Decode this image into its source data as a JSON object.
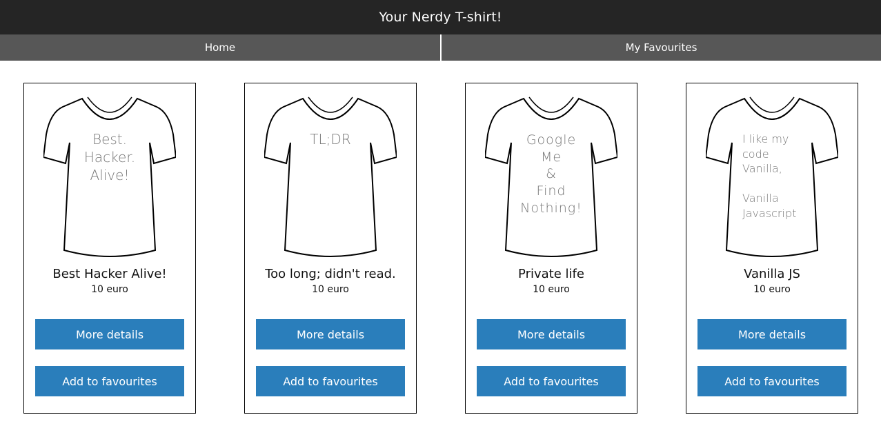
{
  "header": {
    "title": "Your Nerdy T-shirt!"
  },
  "nav": {
    "home": "Home",
    "favourites": "My Favourites"
  },
  "products": [
    {
      "shirt_text": "Best.\nHacker.\nAlive!",
      "title": "Best Hacker Alive!",
      "price": "10 euro",
      "details_label": "More details",
      "fav_label": "Add to favourites"
    },
    {
      "shirt_text": "TL;DR",
      "title": "Too long; didn't read.",
      "price": "10 euro",
      "details_label": "More details",
      "fav_label": "Add to favourites"
    },
    {
      "shirt_text": "Google\nMe\n&\nFind\nNothing!",
      "title": "Private life",
      "price": "10 euro",
      "details_label": "More details",
      "fav_label": "Add to favourites"
    },
    {
      "shirt_text": "I like my\ncode\nVanilla,\n\nVanilla\nJavascript",
      "title": "Vanilla JS",
      "price": "10 euro",
      "details_label": "More details",
      "fav_label": "Add to favourites"
    }
  ],
  "colors": {
    "topbar": "#252525",
    "navbar": "#575757",
    "button": "#2a7ebb"
  },
  "icons": {
    "product_image": "t-shirt-icon"
  }
}
